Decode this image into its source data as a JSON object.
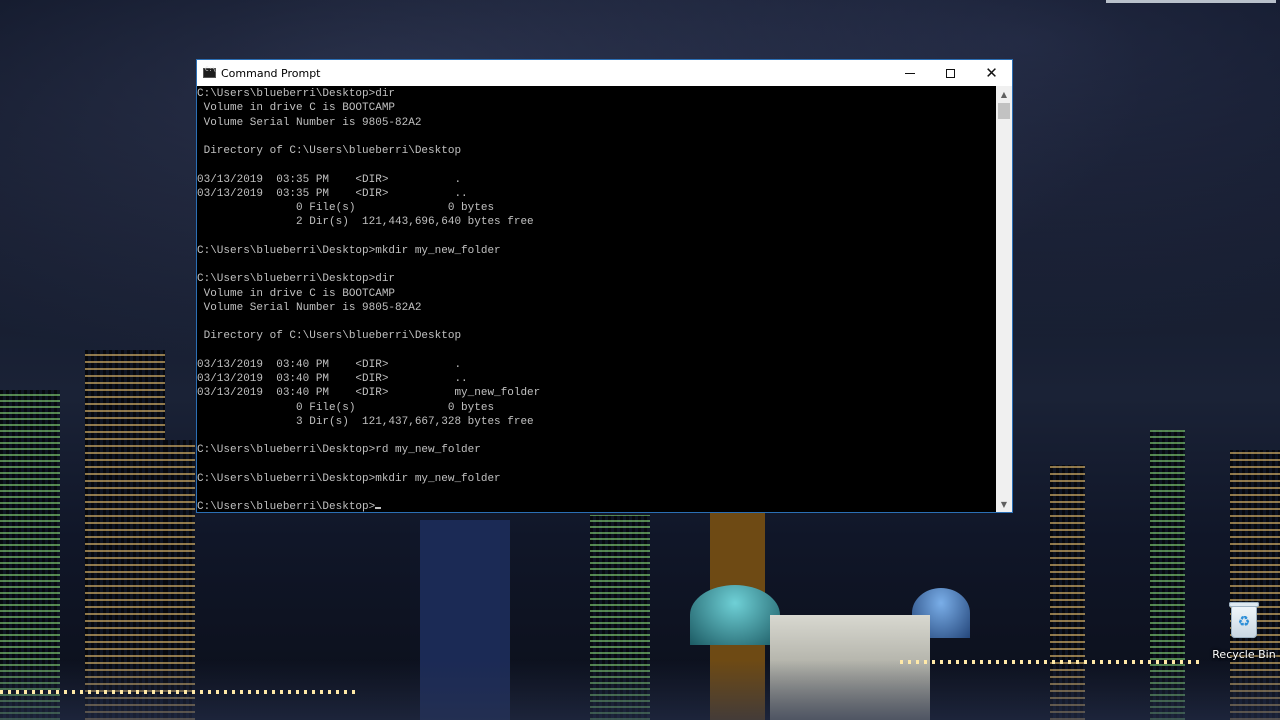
{
  "window": {
    "title": "Command Prompt",
    "icon": "cmd-icon",
    "buttons": {
      "minimize_icon": "minimize-icon",
      "maximize_icon": "maximize-icon",
      "close_icon": "close-icon",
      "close_glyph": "✕"
    }
  },
  "console": {
    "lines": [
      "C:\\Users\\blueberri\\Desktop>dir",
      " Volume in drive C is BOOTCAMP",
      " Volume Serial Number is 9805-82A2",
      "",
      " Directory of C:\\Users\\blueberri\\Desktop",
      "",
      "03/13/2019  03:35 PM    <DIR>          .",
      "03/13/2019  03:35 PM    <DIR>          ..",
      "               0 File(s)              0 bytes",
      "               2 Dir(s)  121,443,696,640 bytes free",
      "",
      "C:\\Users\\blueberri\\Desktop>mkdir my_new_folder",
      "",
      "C:\\Users\\blueberri\\Desktop>dir",
      " Volume in drive C is BOOTCAMP",
      " Volume Serial Number is 9805-82A2",
      "",
      " Directory of C:\\Users\\blueberri\\Desktop",
      "",
      "03/13/2019  03:40 PM    <DIR>          .",
      "03/13/2019  03:40 PM    <DIR>          ..",
      "03/13/2019  03:40 PM    <DIR>          my_new_folder",
      "               0 File(s)              0 bytes",
      "               3 Dir(s)  121,437,667,328 bytes free",
      "",
      "C:\\Users\\blueberri\\Desktop>rd my_new_folder",
      "",
      "C:\\Users\\blueberri\\Desktop>mkdir my_new_folder",
      ""
    ],
    "prompt": "C:\\Users\\blueberri\\Desktop>"
  },
  "desktop": {
    "recycle_bin_label": "Recycle Bin",
    "recycle_symbol": "♻"
  },
  "colors": {
    "console_bg": "#000000",
    "console_text": "#c0c0c0",
    "window_border": "#2b6fb5"
  }
}
